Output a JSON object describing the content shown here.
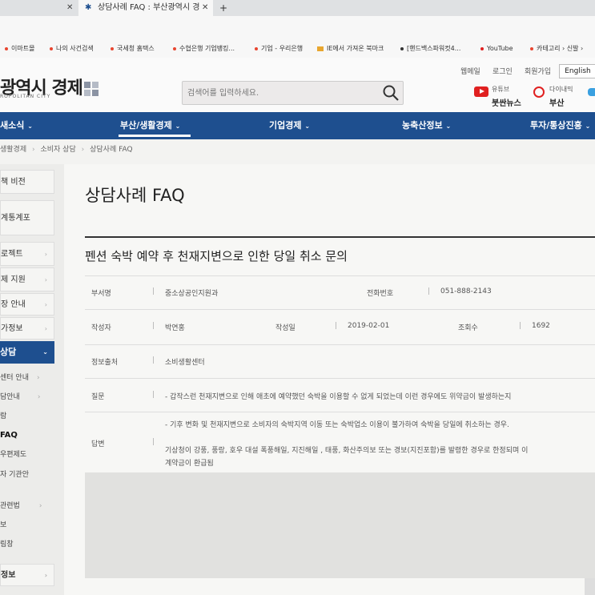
{
  "browser": {
    "tabs": [
      {
        "label": ""
      },
      {
        "label": "상담사례 FAQ : 부산광역시 경제"
      }
    ],
    "new_tab": "+",
    "bookmarks": [
      "이마트몰",
      "나의 사건검색",
      "국세청 홈택스",
      "수협은행 기업뱅킹...",
      "기업 - 우리은행",
      "IE에서 가져온 북마크",
      "[핸드백스파워컷4...",
      "YouTube",
      "카테고리 › 신발 ›"
    ]
  },
  "header": {
    "util_links": [
      "웹메일",
      "로그인",
      "회원가입"
    ],
    "english": "English",
    "logo_text": "광역시 경제",
    "logo_sub": "ROPOLITAN CITY",
    "search_placeholder": "검색어를 입력하세요.",
    "sns": [
      {
        "small": "유튜브",
        "label": "붓싼뉴스"
      },
      {
        "small": "다이내믹",
        "label": "부산"
      }
    ]
  },
  "nav": {
    "items": [
      "새소식",
      "부산/생활경제",
      "기업경제",
      "농축산정보",
      "투자/통상진흥"
    ],
    "active": "부산/생활경제"
  },
  "breadcrumb": [
    "생활경제",
    "소비자 상담",
    "상담사례 FAQ"
  ],
  "sidebar": {
    "boxes": [
      "책 비전",
      "계통계포",
      "로젝트",
      "제 지원",
      "장 안내",
      "가정보"
    ],
    "active": "상담",
    "sub_items": [
      "센터 안내",
      "담안내",
      "람",
      "FAQ",
      "우편제도",
      "자 기관안",
      "관련법",
      "보",
      "림창"
    ],
    "bottom": "정보"
  },
  "content": {
    "page_title": "상담사례 FAQ",
    "question_title": "펜션 숙박 예약 후 천재지변으로 인한 당일 취소 문의",
    "dept_label": "부서명",
    "dept_value": "중소상공인지원과",
    "phone_label": "전화번호",
    "phone_value": "051-888-2143",
    "author_label": "작성자",
    "author_value": "박연홍",
    "date_label": "작성일",
    "date_value": "2019-02-01",
    "views_label": "조회수",
    "views_value": "1692",
    "source_label": "정보출처",
    "source_value": "소비생활센터",
    "question_label": "질문",
    "question_value": "- 갑작스런 천재지변으로 인해 애초에 예약했던 숙박을 이용할 수 없게 되었는데 이런 경우에도 위약금이 발생하는지",
    "answer_label": "답변",
    "answer_line1": "- 기후 변화 및 천재지변으로 소비자의 숙박지역 이동 또는 숙박업소 이용이 불가하여 숙박을 당일에 취소하는 경우.",
    "answer_line2": "기상청이 강풍, 풍랑, 호우 대설 폭풍해일, 지진해일 , 태풍, 화산주의보 또는 경보(지진포함)를 발령한 경우로 한정되며 이",
    "answer_line3": "계약금이 환급됨"
  }
}
